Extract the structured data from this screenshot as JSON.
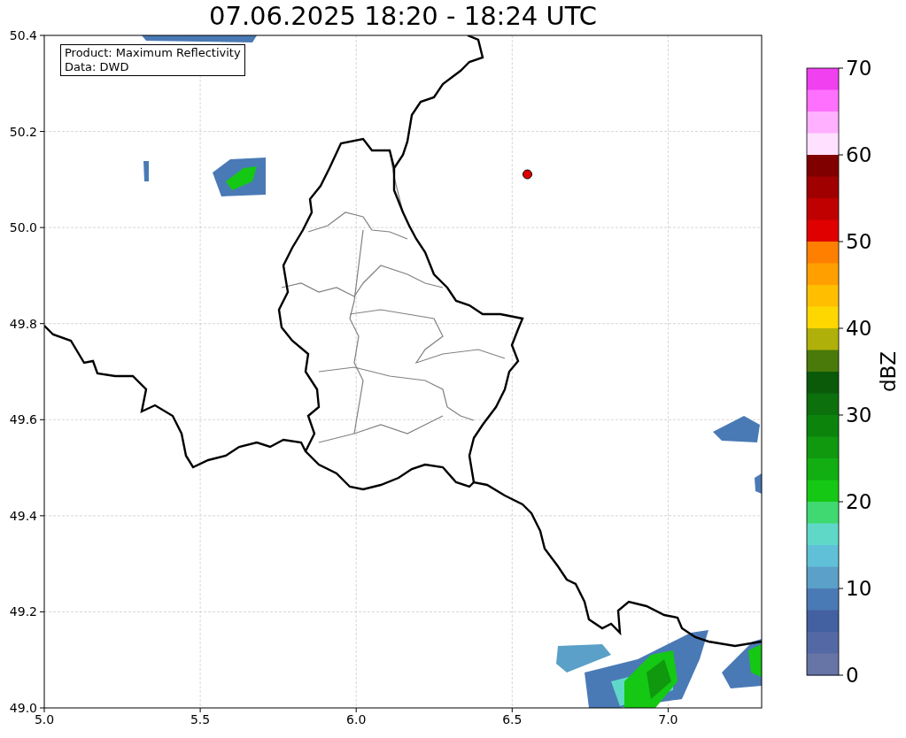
{
  "title": "07.06.2025 18:20 - 18:24 UTC",
  "legend": [
    "Product: Maximum Reflectivity",
    "Data: DWD"
  ],
  "x_axis": {
    "ticks": [
      "5.0",
      "5.5",
      "6.0",
      "6.5",
      "7.0"
    ]
  },
  "y_axis": {
    "ticks": [
      "50.4",
      "50.2",
      "50.0",
      "49.8",
      "49.6",
      "49.4",
      "49.2",
      "49.0"
    ]
  },
  "colorbar": {
    "label": "dBZ",
    "ticks": [
      "70",
      "60",
      "50",
      "40",
      "30",
      "20",
      "10",
      "0"
    ],
    "segments": [
      {
        "color": "#f040f0"
      },
      {
        "color": "#ff70ff"
      },
      {
        "color": "#ffb0ff"
      },
      {
        "color": "#ffe0ff"
      },
      {
        "color": "#800000"
      },
      {
        "color": "#a00000"
      },
      {
        "color": "#c00000"
      },
      {
        "color": "#e00000"
      },
      {
        "color": "#ff8000"
      },
      {
        "color": "#ffa000"
      },
      {
        "color": "#ffbf00"
      },
      {
        "color": "#ffd700"
      },
      {
        "color": "#b0b00a"
      },
      {
        "color": "#4a7a0a"
      },
      {
        "color": "#0a5a0a"
      },
      {
        "color": "#0c700c"
      },
      {
        "color": "#0c840c"
      },
      {
        "color": "#10980f"
      },
      {
        "color": "#12ae12"
      },
      {
        "color": "#14c814"
      },
      {
        "color": "#40d870"
      },
      {
        "color": "#60d8c8"
      },
      {
        "color": "#60c0d8"
      },
      {
        "color": "#5aa0c8"
      },
      {
        "color": "#4a7ab5"
      },
      {
        "color": "#4360a0"
      },
      {
        "color": "#5468a6"
      },
      {
        "color": "#6674a6"
      }
    ]
  }
}
